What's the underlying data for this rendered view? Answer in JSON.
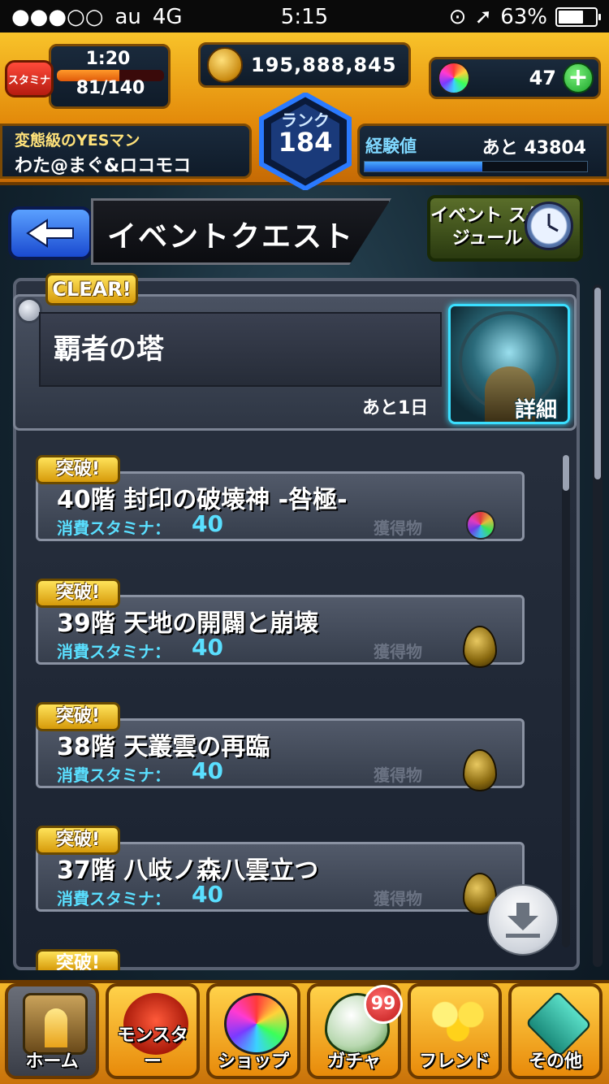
{
  "status_bar": {
    "signal": "●●●○○",
    "carrier": "au",
    "network": "4G",
    "time": "5:15",
    "battery_pct": "63%"
  },
  "hud": {
    "stamina_badge": "スタミナ",
    "stamina_timer": "1:20",
    "stamina_value": "81/140",
    "stamina_fill_fraction": 0.58,
    "gold": "195,888,845",
    "orbs": "47",
    "plus": "+",
    "rank_label": "ランク",
    "rank_value": "184",
    "player_title": "変態級のYESマン",
    "player_name": "わた@まぐ&ロコモコ",
    "exp_label": "経験値",
    "exp_remaining": "あと 43804",
    "exp_fill_fraction": 0.53
  },
  "header": {
    "title": "イベントクエスト",
    "schedule_button": "イベント スケジュール"
  },
  "event": {
    "clear_badge": "CLEAR!",
    "name": "覇者の塔",
    "remaining": "あと1日",
    "detail_label": "詳細"
  },
  "stages": [
    {
      "badge": "突破!",
      "name": "40階 封印の破壊神 -咎極-",
      "stamina_label": "消費スタミナ：",
      "stamina": "40",
      "reward_label": "獲得物",
      "reward": "orb"
    },
    {
      "badge": "突破!",
      "name": "39階 天地の開闢と崩壊",
      "stamina_label": "消費スタミナ：",
      "stamina": "40",
      "reward_label": "獲得物",
      "reward": "egg"
    },
    {
      "badge": "突破!",
      "name": "38階 天叢雲の再臨",
      "stamina_label": "消費スタミナ：",
      "stamina": "40",
      "reward_label": "獲得物",
      "reward": "egg"
    },
    {
      "badge": "突破!",
      "name": "37階 八岐ノ森八雲立つ",
      "stamina_label": "消費スタミナ：",
      "stamina": "40",
      "reward_label": "獲得物",
      "reward": "egg"
    }
  ],
  "partial_badge": "突破!",
  "nav": {
    "items": [
      {
        "label": "ホーム"
      },
      {
        "label": "モンスター"
      },
      {
        "label": "ショップ"
      },
      {
        "label": "ガチャ"
      },
      {
        "label": "フレンド"
      },
      {
        "label": "その他"
      }
    ],
    "gacha_badge": "99"
  },
  "colors": {
    "accent_orange": "#e38a0a",
    "stamina_cyan": "#5adfff",
    "clear_gold": "#ffe35a",
    "back_blue": "#1a4ad0"
  }
}
